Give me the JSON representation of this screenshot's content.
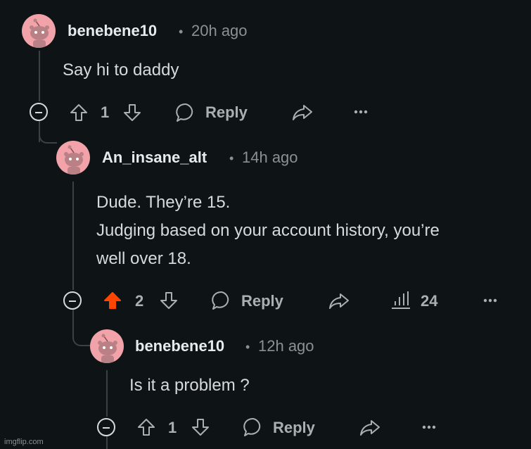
{
  "colors": {
    "background": "#0e1416",
    "upvoted": "#ff4500",
    "text": "#d7dadc",
    "muted": "#8a9196"
  },
  "comments": [
    {
      "username": "benebene10",
      "separator": "•",
      "time": "20h ago",
      "lines": [
        "Say hi to daddy"
      ],
      "upvotes": "1",
      "reply_label": "Reply"
    },
    {
      "username": "An_insane_alt",
      "separator": "•",
      "time": "14h ago",
      "lines": [
        "Dude. They’re 15.",
        "Judging based on your account history, you’re",
        "well over 18."
      ],
      "upvotes": "2",
      "upvoted": true,
      "reply_label": "Reply",
      "views": "24"
    },
    {
      "username": "benebene10",
      "separator": "•",
      "time": "12h ago",
      "lines": [
        "Is it a problem ?"
      ],
      "upvotes": "1",
      "reply_label": "Reply"
    }
  ],
  "icons": {
    "avatar": "snoo-avatar-icon",
    "upvote": "arrow-up-icon",
    "downvote": "arrow-down-icon",
    "reply": "chat-bubble-icon",
    "share": "share-arrow-icon",
    "more": "ellipsis-icon",
    "insights": "bar-chart-icon",
    "collapse": "minus-circle-icon"
  },
  "watermark": "imgflip.com"
}
